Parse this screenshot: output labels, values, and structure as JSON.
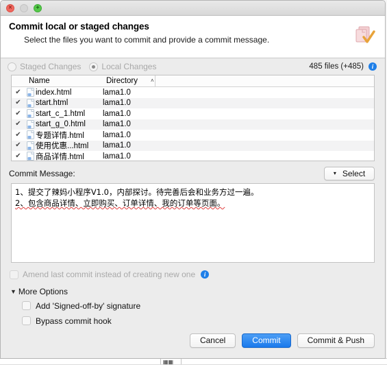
{
  "window": {
    "traffic_lights": [
      {
        "name": "close",
        "glyph": "×"
      },
      {
        "name": "minimize",
        "glyph": ""
      },
      {
        "name": "maximize",
        "glyph": "+"
      }
    ],
    "accent_blue": "#1a79ec",
    "info_blue": "#1f7fe8"
  },
  "header": {
    "title": "Commit local or staged changes",
    "subtitle": "Select the files you want to commit and provide a commit message.",
    "icon": "commit-document-check-icon"
  },
  "source_selector": {
    "options": [
      {
        "label": "Staged Changes",
        "selected": false
      },
      {
        "label": "Local Changes",
        "selected": true
      }
    ],
    "count_text": "485 files (+485)",
    "info_icon": "info-icon"
  },
  "file_table": {
    "columns": [
      "",
      "Name",
      "Directory",
      ""
    ],
    "sort_column": "Directory",
    "sort_caret": "˄",
    "rows": [
      {
        "checked": true,
        "icon": "html-file-icon",
        "name": "index.html",
        "directory": "lama1.0"
      },
      {
        "checked": true,
        "icon": "html-file-icon",
        "name": "start.html",
        "directory": "lama1.0"
      },
      {
        "checked": true,
        "icon": "html-file-icon",
        "name": "start_c_1.html",
        "directory": "lama1.0"
      },
      {
        "checked": true,
        "icon": "html-file-icon",
        "name": "start_g_0.html",
        "directory": "lama1.0"
      },
      {
        "checked": true,
        "icon": "html-file-icon",
        "name": "专题详情.html",
        "directory": "lama1.0"
      },
      {
        "checked": true,
        "icon": "html-file-icon",
        "name": "使用优惠...html",
        "directory": "lama1.0"
      },
      {
        "checked": true,
        "icon": "html-file-icon",
        "name": "商品详情.html",
        "directory": "lama1.0"
      }
    ],
    "check_glyph": "✔"
  },
  "commit_message": {
    "label": "Commit Message:",
    "select_button": "Select",
    "select_caret": "▾",
    "lines": [
      "1、提交了辣妈小程序V1.0，内部探讨。待完善后会和业务方过一遍。",
      "2、包含商品详情、立即购买、订单详情、我的订单等页面。"
    ]
  },
  "amend": {
    "label": "Amend last commit instead of creating new one",
    "checked": false,
    "info_icon": "info-icon"
  },
  "more_options": {
    "label": "More Options",
    "expanded": true,
    "disclosure_glyph": "▼",
    "items": [
      {
        "label": "Add 'Signed-off-by' signature",
        "checked": false
      },
      {
        "label": "Bypass commit hook",
        "checked": false
      }
    ]
  },
  "footer": {
    "buttons": [
      {
        "label": "Cancel",
        "style": "default"
      },
      {
        "label": "Commit",
        "style": "primary"
      },
      {
        "label": "Commit & Push",
        "style": "default"
      }
    ]
  }
}
